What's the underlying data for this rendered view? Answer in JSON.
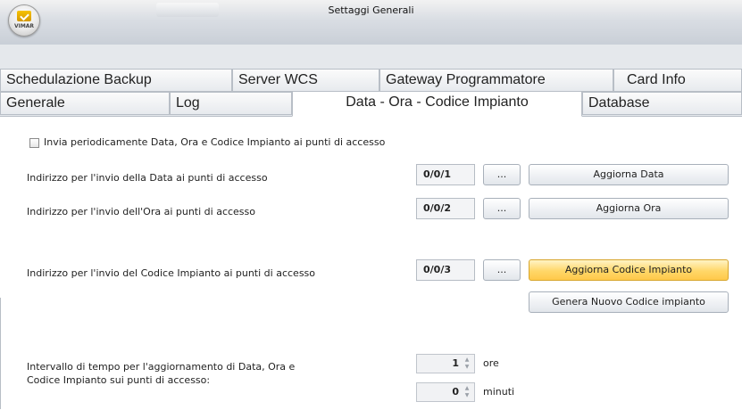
{
  "window": {
    "title": "Settaggi Generali",
    "logo_text": "VIMAR"
  },
  "tabs": {
    "row1": [
      {
        "label": "Schedulazione Backup"
      },
      {
        "label": "Server WCS"
      },
      {
        "label": "Gateway Programmatore"
      },
      {
        "label": "Card Info"
      }
    ],
    "row2": [
      {
        "label": "Generale"
      },
      {
        "label": "Log"
      },
      {
        "label": "Data - Ora - Codice Impianto",
        "active": true
      },
      {
        "label": "Database"
      }
    ]
  },
  "form": {
    "periodic_checkbox": {
      "label": "Invia periodicamente Data, Ora e Codice Impianto ai punti di accesso",
      "checked": false
    },
    "date_row": {
      "label": "Indirizzo per l'invio della Data ai punti di accesso",
      "address": "0/0/1",
      "browse_label": "...",
      "action_label": "Aggiorna Data"
    },
    "time_row": {
      "label": "Indirizzo per l'invio dell'Ora ai punti di accesso",
      "address": "0/0/2",
      "browse_label": "...",
      "action_label": "Aggiorna Ora"
    },
    "code_row": {
      "label": "Indirizzo per l'invio del Codice Impianto ai punti di accesso",
      "address": "0/0/3",
      "browse_label": "...",
      "action_label": "Aggiorna Codice Impianto",
      "generate_label": "Genera Nuovo Codice impianto"
    },
    "interval": {
      "label_line1": "Intervallo di tempo per l'aggiornamento di Data, Ora e",
      "label_line2": "Codice Impianto sui punti di accesso:",
      "hours_value": "1",
      "hours_unit": "ore",
      "minutes_value": "0",
      "minutes_unit": "minuti"
    }
  },
  "icons": {
    "logo": "vimar-logo-icon",
    "spin_up": "spin-up-icon",
    "spin_down": "spin-down-icon"
  },
  "colors": {
    "highlight_button": "#ffd768",
    "title_bar": "#d9dde3"
  }
}
